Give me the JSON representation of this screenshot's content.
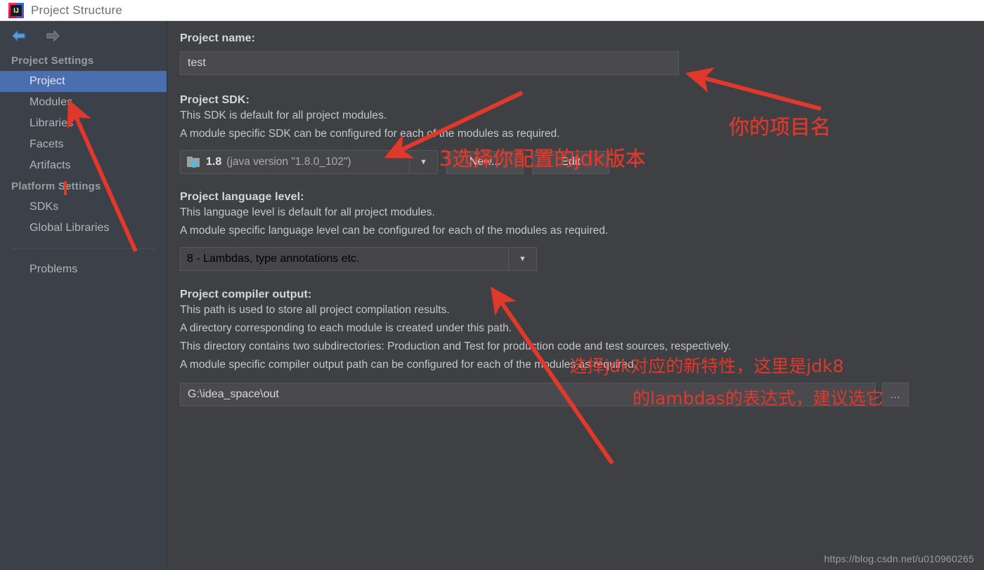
{
  "window": {
    "title": "Project Structure",
    "logo_icon": "intellij-idea-logo"
  },
  "sidebar": {
    "back_icon": "arrow-left-icon",
    "forward_icon": "arrow-right-icon",
    "groups": [
      {
        "header": "Project Settings",
        "items": [
          {
            "label": "Project",
            "selected": true
          },
          {
            "label": "Modules",
            "selected": false
          },
          {
            "label": "Libraries",
            "selected": false
          },
          {
            "label": "Facets",
            "selected": false
          },
          {
            "label": "Artifacts",
            "selected": false
          }
        ]
      },
      {
        "header": "Platform Settings",
        "items": [
          {
            "label": "SDKs",
            "selected": false
          },
          {
            "label": "Global Libraries",
            "selected": false
          }
        ]
      }
    ],
    "footer_items": [
      {
        "label": "Problems",
        "selected": false
      }
    ]
  },
  "main": {
    "project_name": {
      "label": "Project name:",
      "value": "test"
    },
    "project_sdk": {
      "label": "Project SDK:",
      "desc1": "This SDK is default for all project modules.",
      "desc2": "A module specific SDK can be configured for each of the modules as required.",
      "selected_version": "1.8",
      "selected_detail": "(java version \"1.8.0_102\")",
      "icon": "jdk-folder-icon",
      "dropdown_icon": "chevron-down-icon",
      "new_button": "New...",
      "edit_button": "Edit"
    },
    "language_level": {
      "label": "Project language level:",
      "desc1": "This language level is default for all project modules.",
      "desc2": "A module specific language level can be configured for each of the modules as required.",
      "selected": "8 - Lambdas, type annotations etc.",
      "dropdown_icon": "chevron-down-icon"
    },
    "compiler_output": {
      "label": "Project compiler output:",
      "desc1": "This path is used to store all project compilation results.",
      "desc2": "A directory corresponding to each module is created under this path.",
      "desc3": "This directory contains two subdirectories: Production and Test for production code and test sources, respectively.",
      "desc4": "A module specific compiler output path can be configured for each of the modules as required.",
      "value": "G:\\idea_space\\out",
      "browse_button": "...",
      "browse_icon": "ellipsis-icon"
    }
  },
  "annotations": {
    "color": "#e0382b",
    "project_name_note": "你的项目名",
    "sdk_note": "3选择你配置的jdk版本",
    "lang_note_line1": "选择jdk对应的新特性，这里是jdk8",
    "lang_note_line2": "的lambdas的表达式，建议选它",
    "sidebar_marker": "1"
  },
  "watermark": {
    "text": "https://blog.csdn.net/u010960265"
  }
}
